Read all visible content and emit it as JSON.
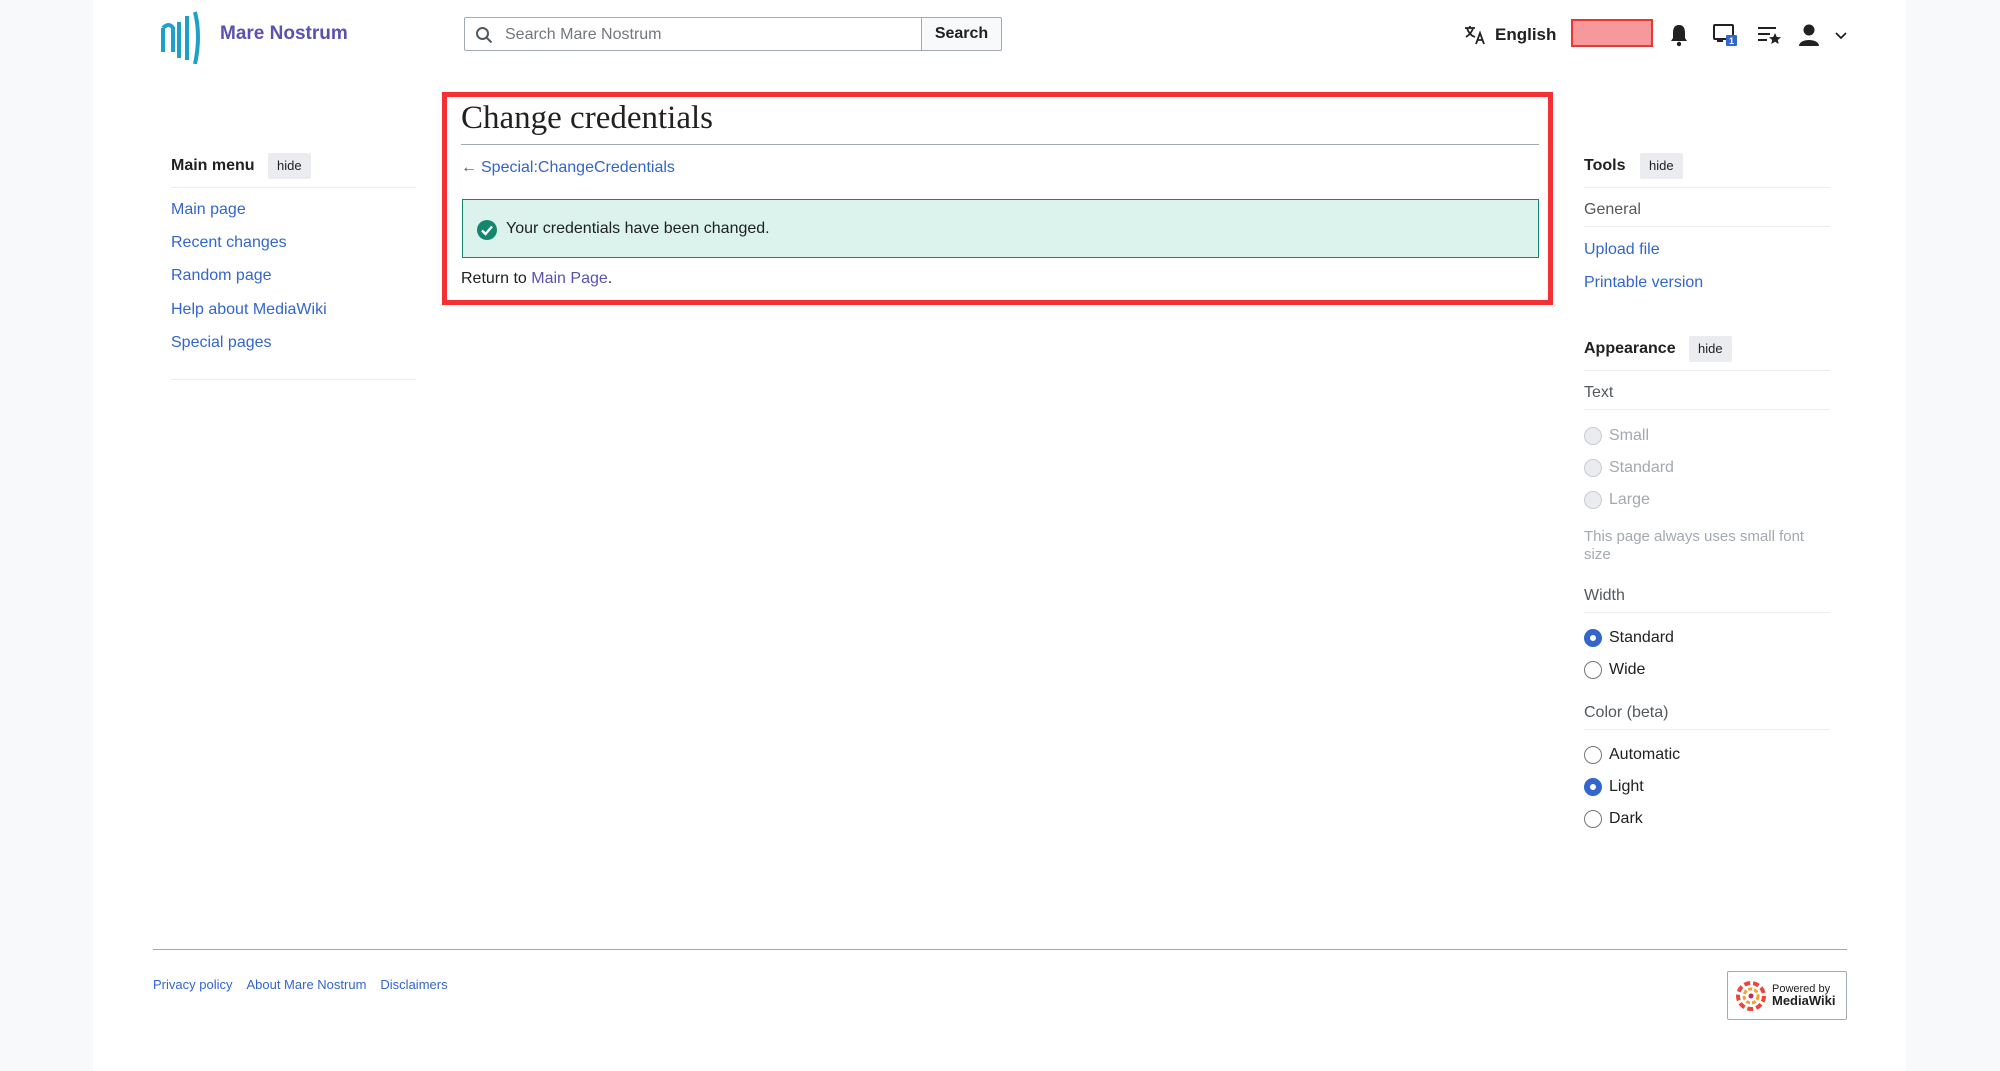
{
  "header": {
    "site_name": "Mare Nostrum",
    "search_placeholder": "Search Mare Nostrum",
    "search_button": "Search",
    "language": "English",
    "icons": [
      "logo-icon",
      "search-icon",
      "translate-icon",
      "bell-icon",
      "watchlist-icon",
      "list-star-icon",
      "user-icon",
      "chevron-down-icon"
    ],
    "notice_count": "1"
  },
  "content": {
    "title": "Change credentials",
    "backlink_arrow": "←",
    "backlink": "Special:ChangeCredentials",
    "success_message": "Your credentials have been changed.",
    "return_prefix": "Return to ",
    "return_link": "Main Page",
    "return_suffix": "."
  },
  "main_menu": {
    "heading": "Main menu",
    "hide": "hide",
    "items": [
      "Main page",
      "Recent changes",
      "Random page",
      "Help about MediaWiki",
      "Special pages"
    ]
  },
  "tools": {
    "heading": "Tools",
    "hide": "hide",
    "general": "General",
    "items": [
      "Upload file",
      "Printable version"
    ]
  },
  "appearance": {
    "heading": "Appearance",
    "hide": "hide",
    "text_heading": "Text",
    "text_options": [
      "Small",
      "Standard",
      "Large"
    ],
    "text_note": "This page always uses small font size",
    "width_heading": "Width",
    "width_options": [
      "Standard",
      "Wide"
    ],
    "width_selected": "Standard",
    "color_heading": "Color (beta)",
    "color_options": [
      "Automatic",
      "Light",
      "Dark"
    ],
    "color_selected": "Light"
  },
  "footer": {
    "links": [
      "Privacy policy",
      "About Mare Nostrum",
      "Disclaimers"
    ],
    "powered_line1": "Powered by",
    "powered_line2": "MediaWiki"
  },
  "colors": {
    "accent": "#3366cc",
    "highlight_border": "#f33135",
    "success_bg": "#dbf3ec",
    "success_border": "#14866d",
    "redact_fill": "#f7999b"
  }
}
